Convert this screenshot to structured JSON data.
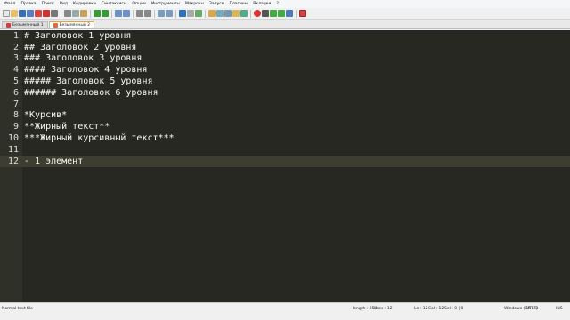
{
  "menubar": {
    "items": [
      "Файл",
      "Правка",
      "Поиск",
      "Вид",
      "Кодировки",
      "Синтаксисы",
      "Опции",
      "Инструменты",
      "Макросы",
      "Запуск",
      "Плагины",
      "Вкладки",
      "?"
    ]
  },
  "toolbar": {
    "icons": [
      "new-file-icon",
      "open-file-icon",
      "save-icon",
      "save-all-icon",
      "close-icon",
      "close-all-icon",
      "print-icon",
      "cut-icon",
      "copy-icon",
      "paste-icon",
      "undo-icon",
      "redo-icon",
      "find-icon",
      "replace-icon",
      "zoom-in-icon",
      "zoom-out-icon",
      "sync-vertical-icon",
      "sync-horizontal-icon",
      "word-wrap-icon",
      "show-all-chars-icon",
      "indent-guide-icon",
      "language-icon",
      "doc-map-icon",
      "function-list-icon",
      "folder-workspace-icon",
      "monitoring-icon",
      "record-macro-icon",
      "stop-record-icon",
      "playback-icon",
      "run-macro-icon",
      "save-macro-icon",
      "spell-check-icon"
    ]
  },
  "tabs": [
    {
      "label": "Безымянный 1",
      "active": false
    },
    {
      "label": "Безымянный 2",
      "active": true
    }
  ],
  "editor": {
    "lines": [
      {
        "num": "1",
        "text": "# Заголовок 1 уровня"
      },
      {
        "num": "2",
        "text": "## Заголовок 2 уровня"
      },
      {
        "num": "3",
        "text": "### Заголовок 3 уровня"
      },
      {
        "num": "4",
        "text": "#### Заголовок 4 уровня"
      },
      {
        "num": "5",
        "text": "##### Заголовок 5 уровня"
      },
      {
        "num": "6",
        "text": "###### Заголовок 6 уровня"
      },
      {
        "num": "7",
        "text": ""
      },
      {
        "num": "8",
        "text": "*Курсив*"
      },
      {
        "num": "9",
        "text": "**Жирный текст**"
      },
      {
        "num": "10",
        "text": "***Жирный курсивный текст***"
      },
      {
        "num": "11",
        "text": ""
      },
      {
        "num": "12",
        "text": "- 1 элемент"
      }
    ],
    "current_line": 12
  },
  "statusbar": {
    "file_type": "Normal text file",
    "length": "length : 254",
    "lines": "lines : 12",
    "ln": "Ln : 12",
    "col": "Col : 12",
    "sel": "Sel : 0 | 0",
    "eol": "Windows (CR LF)",
    "encoding": "UTF-8",
    "mode": "INS"
  },
  "colors": {
    "editor_bg": "#272822",
    "current_line_bg": "#3e3d32",
    "text": "#f8f8f2",
    "tab_accent": "#e8a33b"
  }
}
